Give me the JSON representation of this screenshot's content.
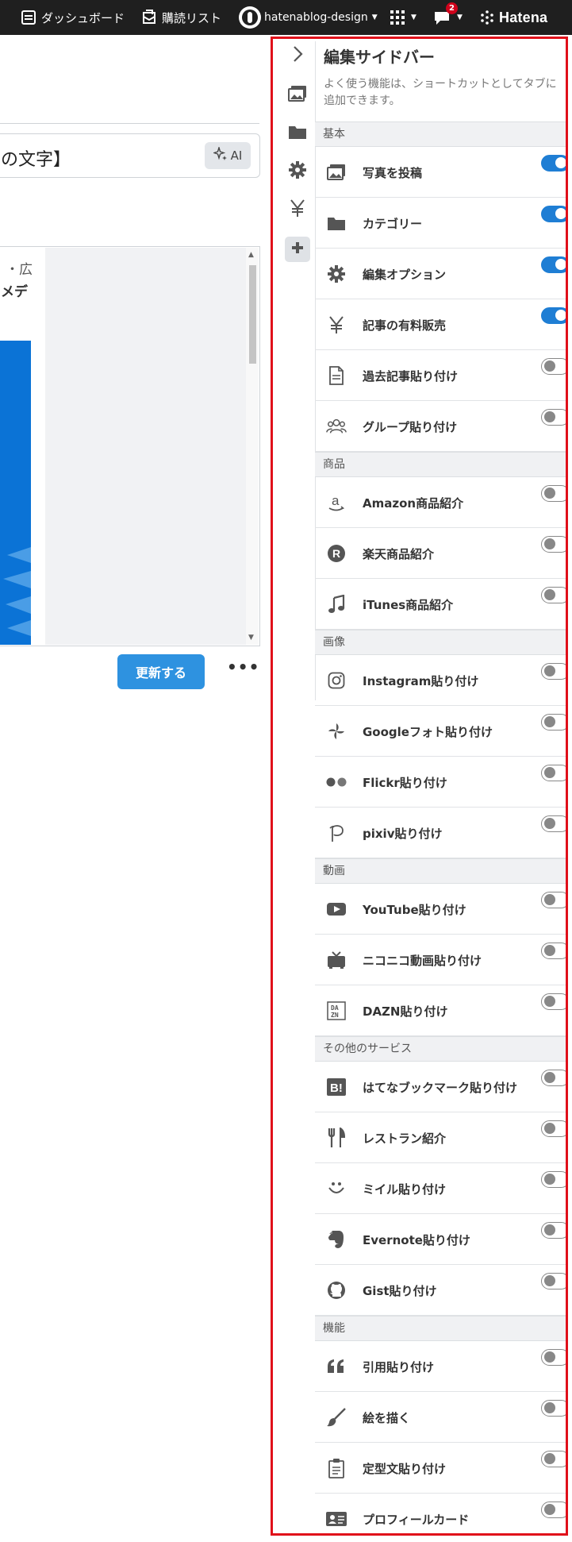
{
  "topbar": {
    "dashboard_label": "ダッシュボード",
    "reading_list_label": "購読リスト",
    "blog_name": "hatenablog-design",
    "notification_count": "2",
    "brand": "Hatena"
  },
  "editor": {
    "title_value": "の文字】",
    "ai_label": "AI",
    "preview_text_1": "・広",
    "preview_text_2": "メデ",
    "update_button": "更新する",
    "more_button": "•••"
  },
  "sidebar": {
    "title": "編集サイドバー",
    "description": "よく使う機能は、ショートカットとしてタブに追加できます。",
    "rail_icons": [
      "chevron-right-icon",
      "photo-icon",
      "folder-icon",
      "gear-icon",
      "yen-icon",
      "plus-icon"
    ],
    "sections": [
      {
        "label": "基本",
        "items": [
          {
            "label": "写真を投稿",
            "icon": "photo-icon",
            "enabled": true
          },
          {
            "label": "カテゴリー",
            "icon": "folder-icon",
            "enabled": true
          },
          {
            "label": "編集オプション",
            "icon": "gear-icon",
            "enabled": true
          },
          {
            "label": "記事の有料販売",
            "icon": "yen-icon",
            "enabled": true
          },
          {
            "label": "過去記事貼り付け",
            "icon": "document-icon",
            "enabled": false
          },
          {
            "label": "グループ貼り付け",
            "icon": "group-icon",
            "enabled": false
          }
        ]
      },
      {
        "label": "商品",
        "items": [
          {
            "label": "Amazon商品紹介",
            "icon": "amazon-icon",
            "enabled": false
          },
          {
            "label": "楽天商品紹介",
            "icon": "rakuten-icon",
            "enabled": false
          },
          {
            "label": "iTunes商品紹介",
            "icon": "music-note-icon",
            "enabled": false
          }
        ]
      },
      {
        "label": "画像",
        "items": [
          {
            "label": "Instagram貼り付け",
            "icon": "instagram-icon",
            "enabled": false
          },
          {
            "label": "Googleフォト貼り付け",
            "icon": "pinwheel-icon",
            "enabled": false
          },
          {
            "label": "Flickr貼り付け",
            "icon": "flickr-icon",
            "enabled": false
          },
          {
            "label": "pixiv貼り付け",
            "icon": "pixiv-icon",
            "enabled": false
          }
        ]
      },
      {
        "label": "動画",
        "items": [
          {
            "label": "YouTube貼り付け",
            "icon": "youtube-icon",
            "enabled": false
          },
          {
            "label": "ニコニコ動画貼り付け",
            "icon": "tv-icon",
            "enabled": false
          },
          {
            "label": "DAZN貼り付け",
            "icon": "dazn-icon",
            "enabled": false
          }
        ]
      },
      {
        "label": "その他のサービス",
        "items": [
          {
            "label": "はてなブックマーク貼り付け",
            "icon": "bookmark-b-icon",
            "enabled": false
          },
          {
            "label": "レストラン紹介",
            "icon": "fork-knife-icon",
            "enabled": false
          },
          {
            "label": "ミイル貼り付け",
            "icon": "smile-icon",
            "enabled": false
          },
          {
            "label": "Evernote貼り付け",
            "icon": "evernote-icon",
            "enabled": false
          },
          {
            "label": "Gist貼り付け",
            "icon": "github-icon",
            "enabled": false
          }
        ]
      },
      {
        "label": "機能",
        "items": [
          {
            "label": "引用貼り付け",
            "icon": "quote-icon",
            "enabled": false
          },
          {
            "label": "絵を描く",
            "icon": "paintbrush-icon",
            "enabled": false
          },
          {
            "label": "定型文貼り付け",
            "icon": "clipboard-icon",
            "enabled": false
          },
          {
            "label": "プロフィールカード",
            "icon": "id-card-icon",
            "enabled": false
          }
        ]
      }
    ]
  }
}
